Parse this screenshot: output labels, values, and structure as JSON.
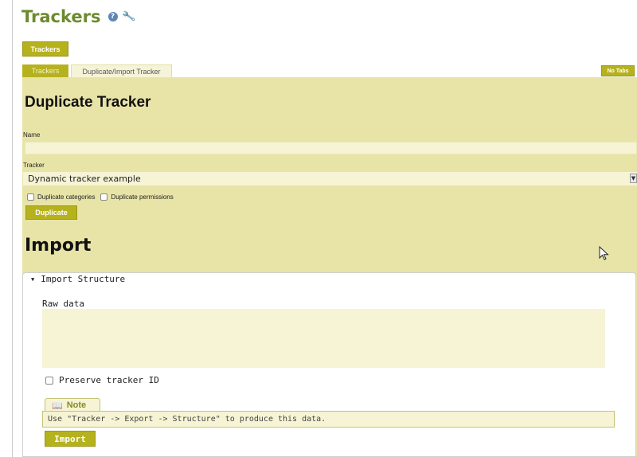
{
  "header": {
    "title": "Trackers",
    "help_icon": "help-icon",
    "settings_icon": "wrench-icon"
  },
  "toolbar": {
    "trackers_label": "Trackers"
  },
  "tabs": [
    {
      "label": "Trackers",
      "active": false
    },
    {
      "label": "Duplicate/Import Tracker",
      "active": true
    }
  ],
  "no_tabs_label": "No Tabs",
  "duplicate": {
    "heading": "Duplicate Tracker",
    "name_label": "Name",
    "name_value": "",
    "tracker_label": "Tracker",
    "tracker_selected": "Dynamic tracker example",
    "dup_categories_label": "Duplicate categories",
    "dup_permissions_label": "Duplicate permissions",
    "button_label": "Duplicate"
  },
  "import": {
    "heading": "Import",
    "section_title": "Import Structure",
    "raw_label": "Raw data",
    "raw_value": "",
    "preserve_label": "Preserve tracker ID",
    "note_title": "Note",
    "note_text": "Use \"Tracker -> Export -> Structure\" to produce this data.",
    "button_label": "Import"
  },
  "colors": {
    "accent": "#b6b21d",
    "panel": "#e8e4a8",
    "title": "#6c8b2d"
  }
}
